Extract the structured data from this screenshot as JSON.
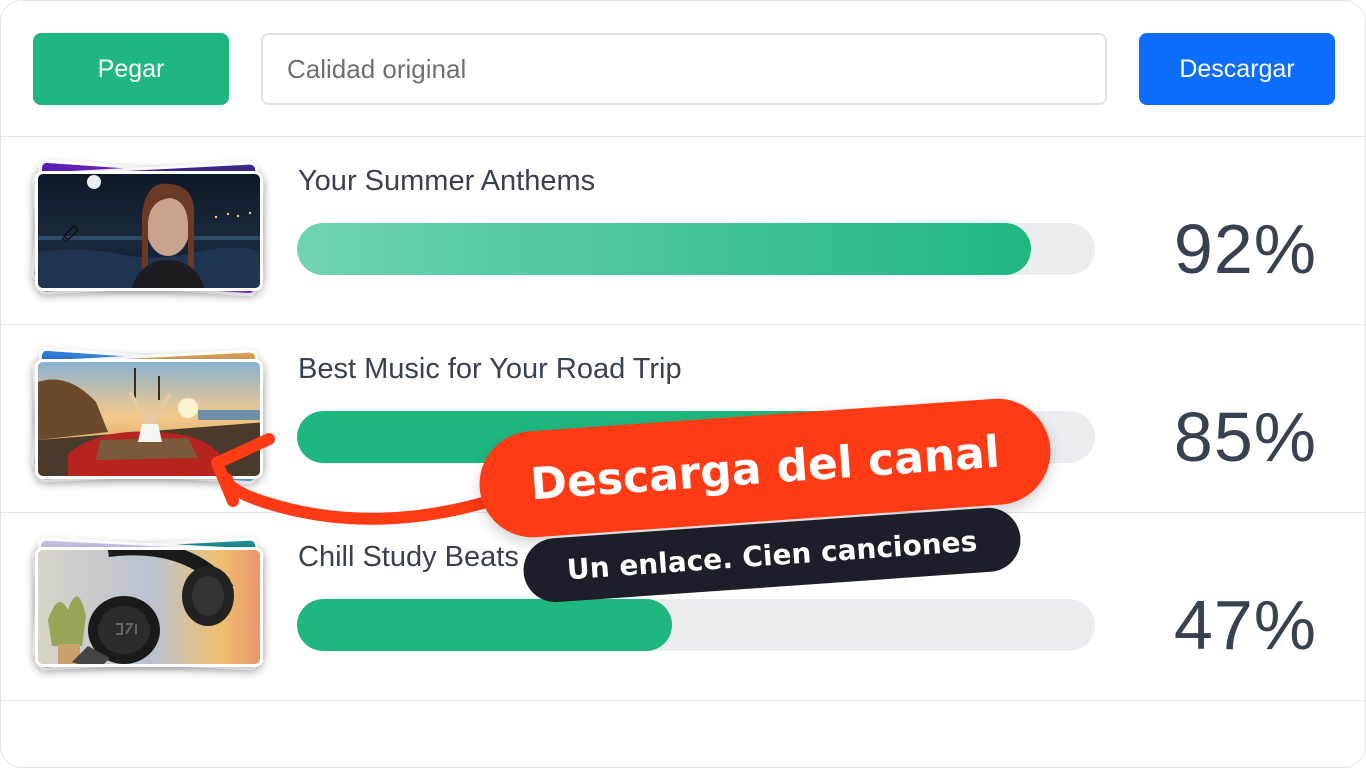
{
  "toolbar": {
    "paste_label": "Pegar",
    "quality_placeholder": "Calidad original",
    "download_label": "Descargar"
  },
  "rows": [
    {
      "title": "Your Summer Anthems",
      "percent_text": "92%",
      "progress": 0.92,
      "thumbnail_icon": "portrait-night-sea-thumbnail"
    },
    {
      "title": "Best Music for Your Road Trip",
      "percent_text": "85%",
      "progress": 0.85,
      "thumbnail_icon": "convertible-sunset-road-thumbnail"
    },
    {
      "title": "Chill Study Beats",
      "percent_text": "47%",
      "progress": 0.47,
      "thumbnail_icon": "headphones-thumbnail"
    }
  ],
  "promo": {
    "title": "Descarga del canal",
    "subtitle": "Un enlace. Cien canciones"
  },
  "colors": {
    "green": "#20b77f",
    "blue": "#0d6efd",
    "promo_red": "#ff3b15",
    "promo_dark": "#1c1f2a",
    "text": "#374151"
  }
}
